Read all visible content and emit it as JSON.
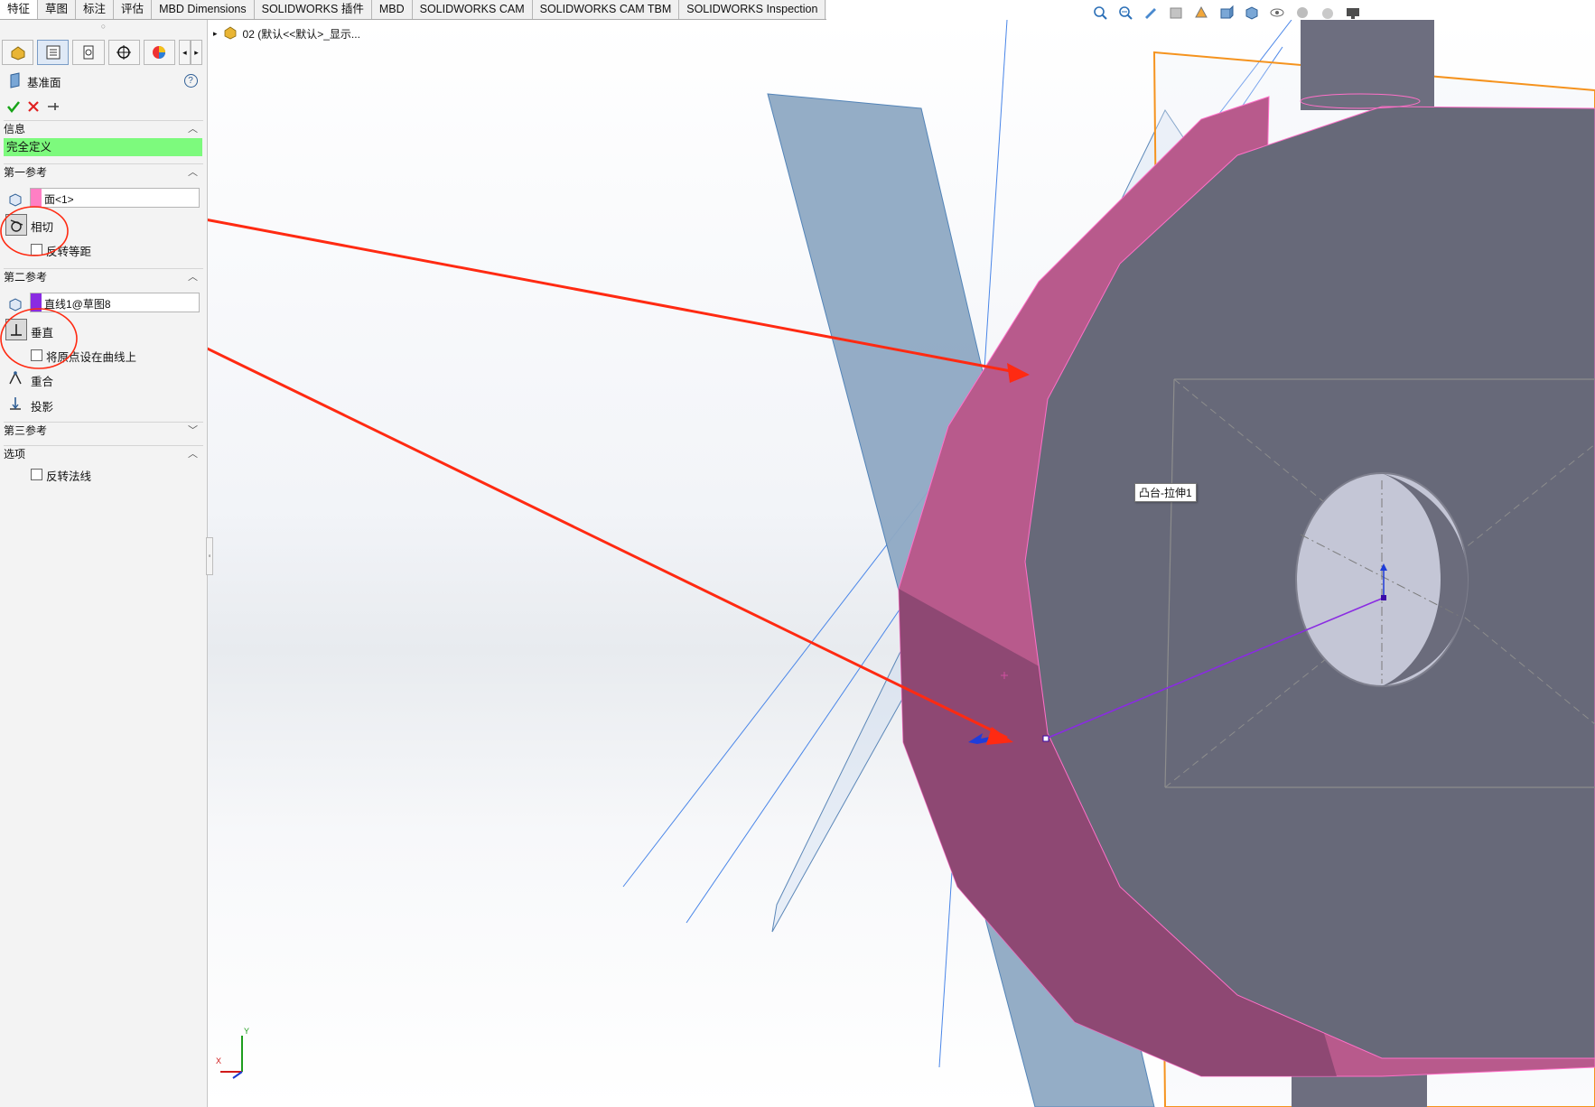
{
  "tabs": [
    "特征",
    "草图",
    "标注",
    "评估",
    "MBD Dimensions",
    "SOLIDWORKS 插件",
    "MBD",
    "SOLIDWORKS CAM",
    "SOLIDWORKS CAM TBM",
    "SOLIDWORKS Inspection"
  ],
  "feature_tree": {
    "root_label": "02 (默认<<默认>_显示..."
  },
  "property_manager": {
    "title": "基准面",
    "help": "?",
    "info_section": "信息",
    "status": "完全定义",
    "status_color": "#7dfa7d",
    "first_ref": {
      "heading": "第一参考",
      "selection": "面<1>",
      "selection_color": "#ff7fc4",
      "constraint": "相切",
      "option": "反转等距"
    },
    "second_ref": {
      "heading": "第二参考",
      "selection": "直线1@草图8",
      "selection_color": "#8a2be2",
      "constraint": "垂直",
      "option": "将原点设在曲线上",
      "extra1": "重合",
      "extra2": "投影"
    },
    "third_ref": {
      "heading": "第三参考"
    },
    "options": {
      "heading": "选项",
      "option": "反转法线"
    }
  },
  "viewport": {
    "feature_tag": "凸台-拉伸1",
    "triad_label": "X"
  },
  "colors": {
    "annotation_red": "#ff2a12",
    "plane_blue": "#7f9fbf",
    "face_pink": "#c8508c",
    "body_gray": "#676979",
    "sketch_purple": "#8a2be2",
    "plane_orange": "#f5931e"
  }
}
